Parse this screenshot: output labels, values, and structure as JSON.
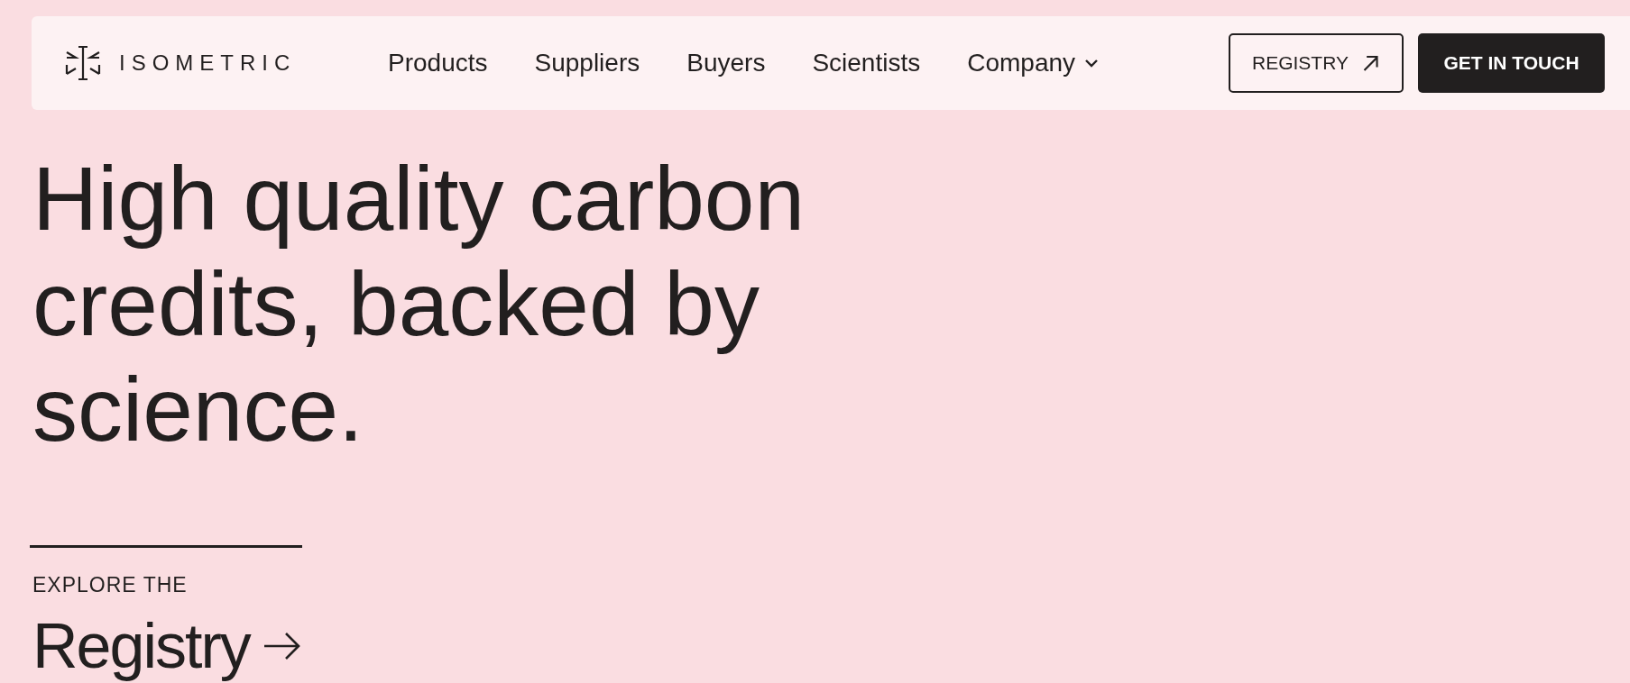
{
  "header": {
    "logo": "ISOMETRIC",
    "nav": [
      {
        "label": "Products",
        "dropdown": false
      },
      {
        "label": "Suppliers",
        "dropdown": false
      },
      {
        "label": "Buyers",
        "dropdown": false
      },
      {
        "label": "Scientists",
        "dropdown": false
      },
      {
        "label": "Company",
        "dropdown": true
      }
    ],
    "buttons": [
      {
        "label": "REGISTRY",
        "kind": "outline"
      },
      {
        "label": "GET IN TOUCH",
        "kind": "solid"
      }
    ]
  },
  "hero": {
    "headline": [
      "High quality carbon",
      "credits, backed by",
      "science."
    ],
    "eyebrow": "EXPLORE THE",
    "link": "Registry"
  }
}
